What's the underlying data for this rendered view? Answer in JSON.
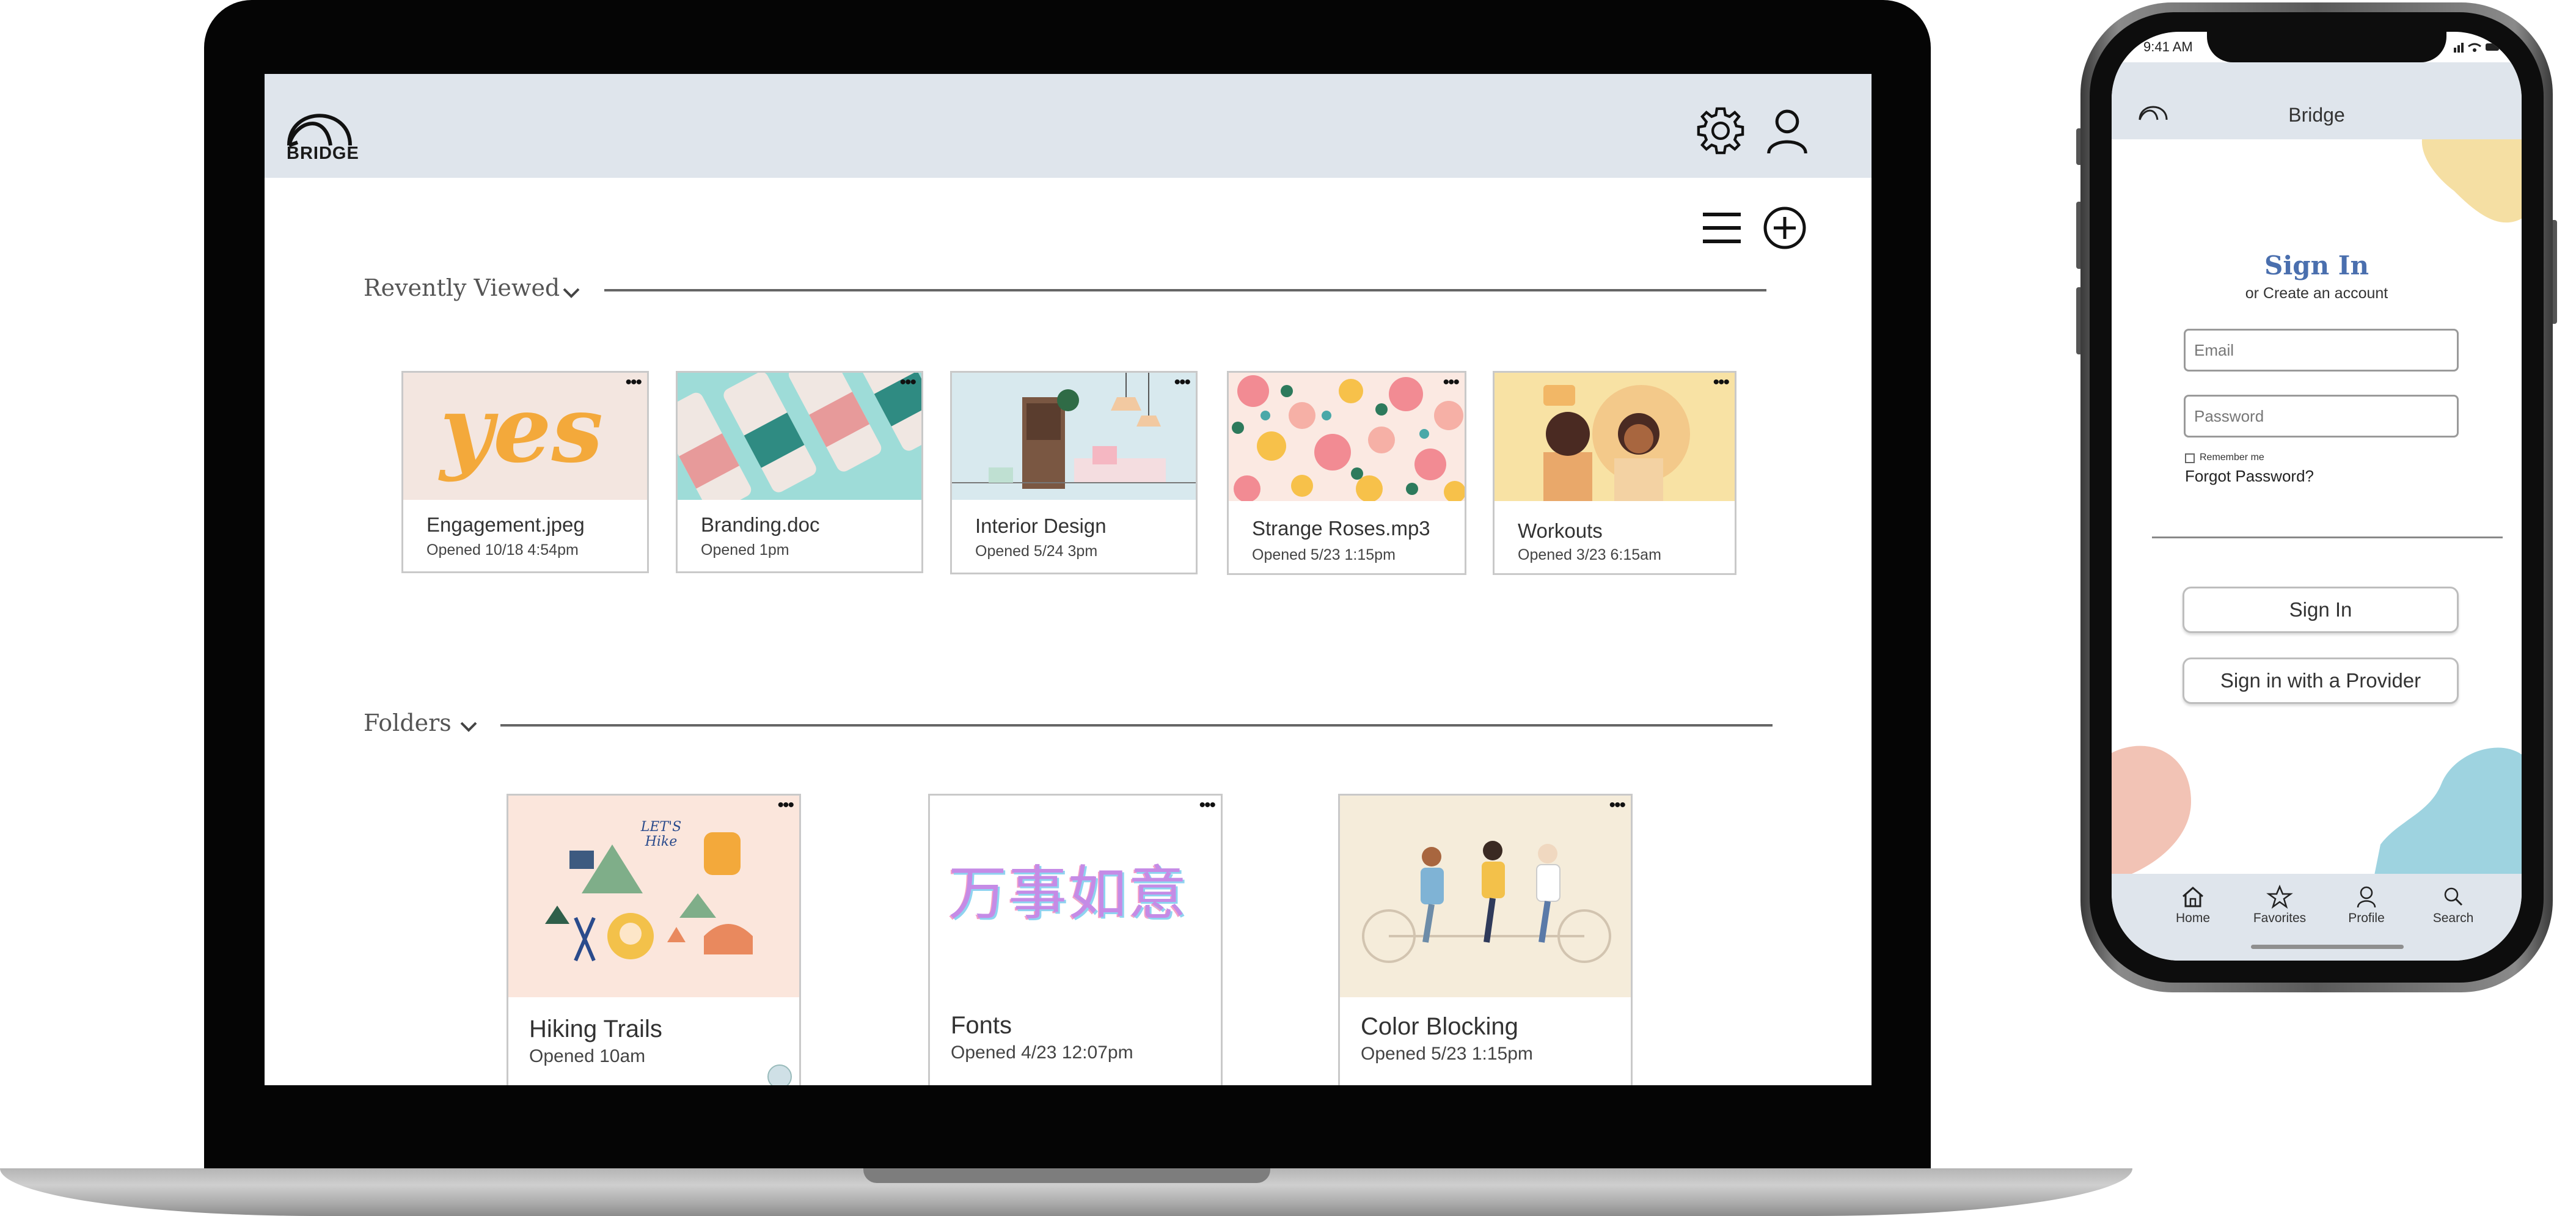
{
  "desktop": {
    "brand": "BRIDGE",
    "recent": {
      "title": "Revently Viewed",
      "items": [
        {
          "name": "Engagement.jpeg",
          "opened": "Opened 10/18 4:54pm",
          "thumb_text": "yes"
        },
        {
          "name": "Branding.doc",
          "opened": "Opened 1pm"
        },
        {
          "name": "Interior Design",
          "opened": "Opened 5/24 3pm"
        },
        {
          "name": "Strange Roses.mp3",
          "opened": "Opened 5/23  1:15pm"
        },
        {
          "name": "Workouts",
          "opened": "Opened 3/23  6:15am"
        }
      ]
    },
    "folders": {
      "title": "Folders",
      "items": [
        {
          "name": "Hiking Trails",
          "opened": "Opened 10am",
          "thumb_text": "LET'S Hike"
        },
        {
          "name": "Fonts",
          "opened": "Opened 4/23 12:07pm",
          "thumb_text": "万事如意"
        },
        {
          "name": "Color Blocking",
          "opened": "Opened 5/23  1:15pm"
        }
      ]
    },
    "more_label": "•••"
  },
  "phone": {
    "time": "9:41 AM",
    "title": "Bridge",
    "signin_title": "Sign In",
    "subtitle": "or Create an account",
    "email_placeholder": "Email",
    "password_placeholder": "Password",
    "remember": "Remember me",
    "forgot": "Forgot Password?",
    "signin_button": "Sign In",
    "provider_button": "Sign in with a Provider",
    "tabs": [
      {
        "label": "Home",
        "icon": "home-icon"
      },
      {
        "label": "Favorites",
        "icon": "star-icon"
      },
      {
        "label": "Profile",
        "icon": "profile-icon"
      },
      {
        "label": "Search",
        "icon": "search-icon"
      }
    ]
  },
  "colors": {
    "header_bg": "#dfe5ec",
    "signin_title": "#4a6fae",
    "blob_yellow": "#f5dfa3",
    "blob_pink": "#f2c3b5",
    "blob_blue": "#9ed3e0"
  }
}
